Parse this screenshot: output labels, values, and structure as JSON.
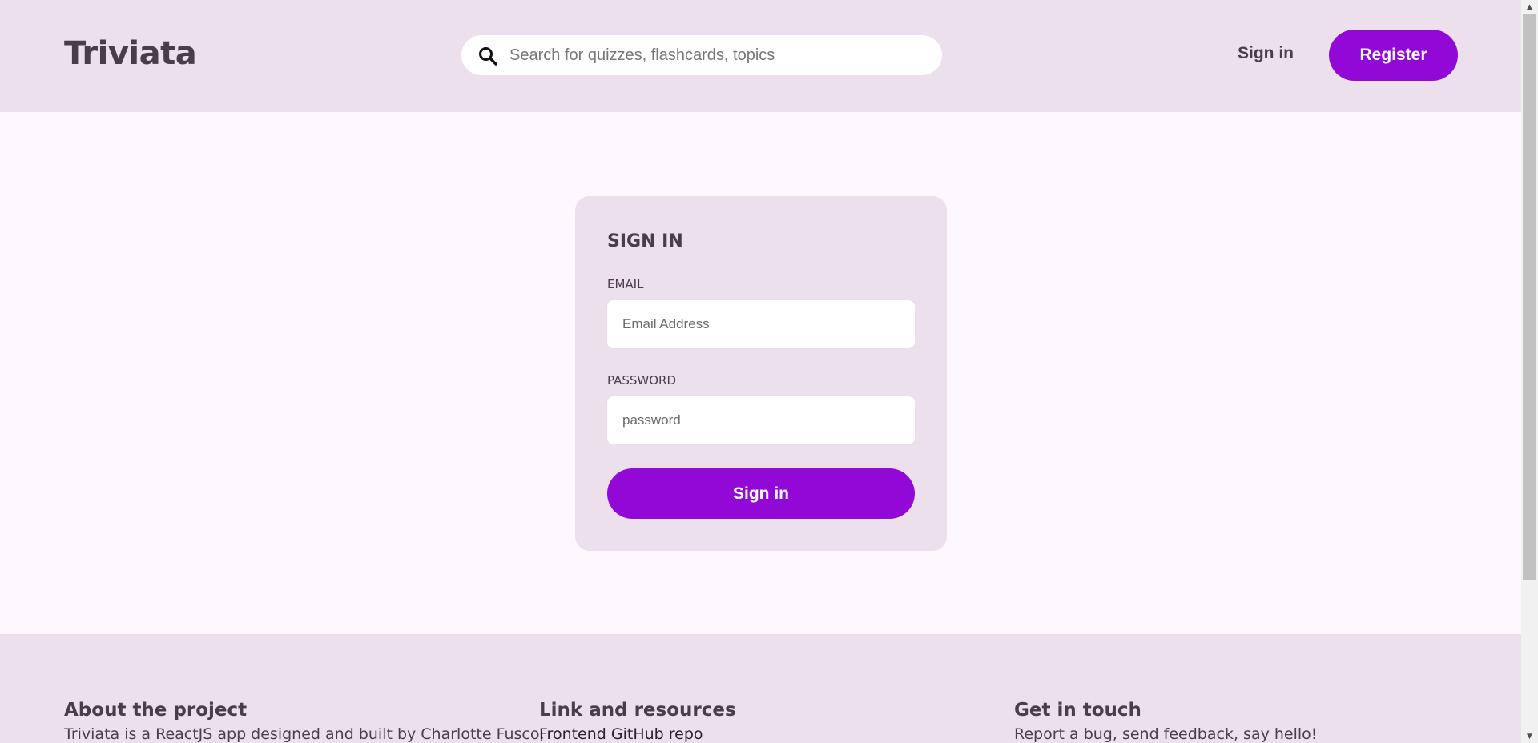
{
  "header": {
    "logo": "Triviata",
    "search_placeholder": "Search for quizzes, flashcards, topics",
    "search_icon": "search-icon",
    "signin_label": "Sign in",
    "register_label": "Register"
  },
  "signin_form": {
    "title": "SIGN IN",
    "email_label": "EMAIL",
    "email_placeholder": "Email Address",
    "email_value": "",
    "password_label": "PASSWORD",
    "password_placeholder": "password",
    "password_value": "",
    "submit_label": "Sign in"
  },
  "footer": {
    "about": {
      "heading": "About the project",
      "text": "Triviata is a ReactJS app designed and built by Charlotte Fusco,"
    },
    "links": {
      "heading": "Link and resources",
      "items": [
        "Frontend GitHub repo"
      ]
    },
    "contact": {
      "heading": "Get in touch",
      "text": "Report a bug, send feedback, say hello!"
    }
  },
  "colors": {
    "accent": "#9208d6",
    "panel": "#ebe0eb",
    "background": "#fdf8fd",
    "text": "#4a3d4a"
  }
}
